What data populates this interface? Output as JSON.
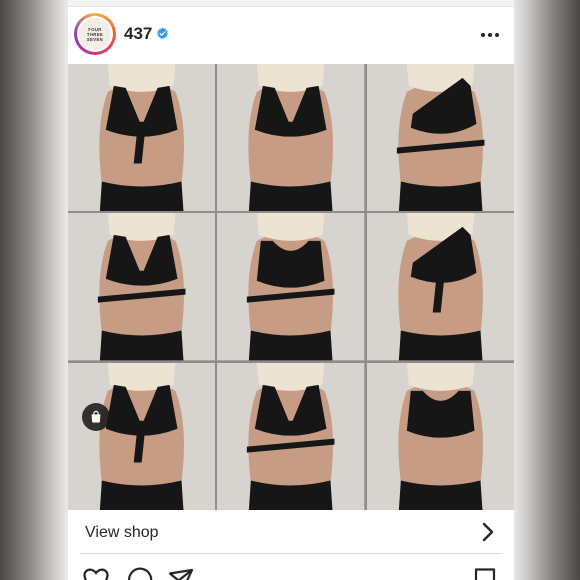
{
  "post": {
    "account": {
      "username": "437",
      "verified": true,
      "avatar_text": [
        "FOUR",
        "THREE",
        "SEVEN"
      ]
    },
    "menu_icon": "more-horizontal-icon",
    "grid": {
      "rows": 3,
      "columns": 3,
      "cells": [
        {
          "style": "tie-front-triangle"
        },
        {
          "style": "strappy-halter"
        },
        {
          "style": "one-shoulder-wrap"
        },
        {
          "style": "wrap-strap-plunge"
        },
        {
          "style": "scoop-neck-wrap"
        },
        {
          "style": "one-shoulder-tie"
        },
        {
          "style": "tie-front-plunge"
        },
        {
          "style": "wrap-cross-front"
        },
        {
          "style": "scoop-neck-sport"
        }
      ]
    },
    "shop": {
      "label": "View shop",
      "bag_icon": "shopping-bag-icon",
      "arrow_icon": "chevron-right-icon"
    },
    "actions": [
      "heart-icon",
      "comment-icon",
      "share-icon",
      "bookmark-icon"
    ]
  },
  "colors": {
    "swimsuit": "#161616",
    "skin": "#c79c84",
    "wall": "#d7d3cf",
    "hair": "#ece3d3",
    "verified_badge": "#3897f0",
    "text": "#262626"
  }
}
